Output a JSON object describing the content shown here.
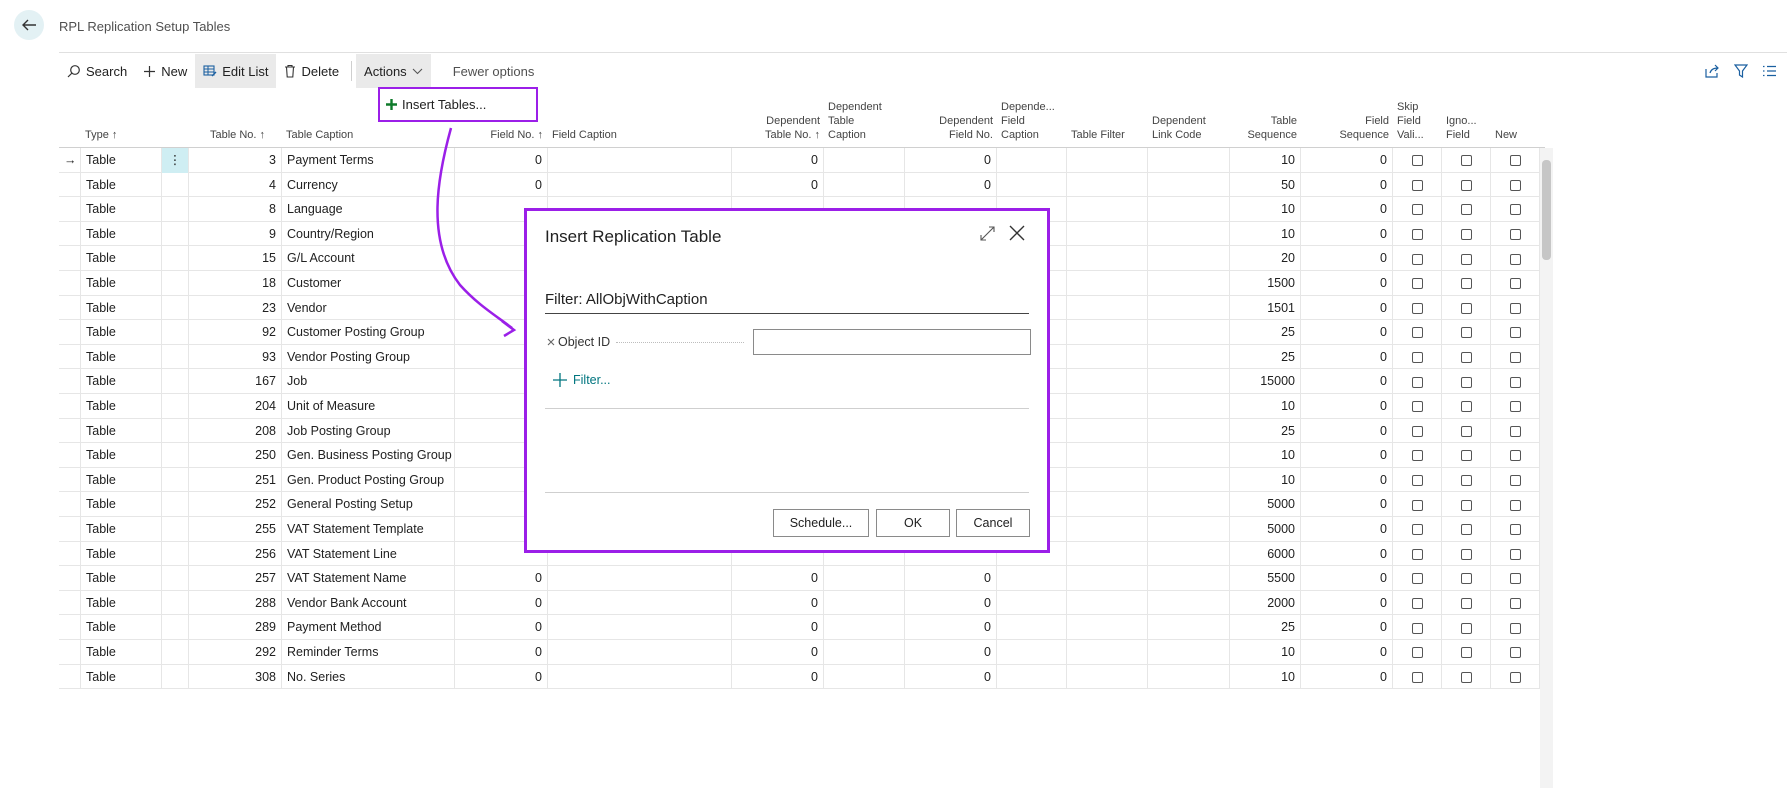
{
  "page": {
    "title": "RPL Replication Setup Tables"
  },
  "toolbar": {
    "search": "Search",
    "new": "New",
    "edit_list": "Edit List",
    "delete": "Delete",
    "actions": "Actions",
    "fewer_options": "Fewer options"
  },
  "dropdown": {
    "insert_tables": "Insert Tables..."
  },
  "columns": {
    "type": "Type ↑",
    "table_no": "Table No. ↑",
    "table_caption": "Table Caption",
    "field_no": "Field No. ↑",
    "field_caption": "Field Caption",
    "dep_table_no_1": "Dependent",
    "dep_table_no_2": "Table No. ↑",
    "dep_table_caption_1": "Dependent",
    "dep_table_caption_2": "Table",
    "dep_table_caption_3": "Caption",
    "dep_field_no_1": "Dependent",
    "dep_field_no_2": "Field No.",
    "dep_field_caption_1": "Depende...",
    "dep_field_caption_2": "Field",
    "dep_field_caption_3": "Caption",
    "table_filter": "Table Filter",
    "dep_link_code_1": "Dependent",
    "dep_link_code_2": "Link Code",
    "table_seq_1": "Table",
    "table_seq_2": "Sequence",
    "field_seq_1": "Field",
    "field_seq_2": "Sequence",
    "skip_1": "Skip",
    "skip_2": "Field",
    "skip_3": "Vali...",
    "ignore_1": "Igno...",
    "ignore_2": "Field",
    "new": "New"
  },
  "rows": [
    {
      "type": "Table",
      "table_no": "3",
      "caption": "Payment Terms",
      "field_no": "0",
      "dep_table_no": "0",
      "dep_field_no": "0",
      "table_seq": "10",
      "field_seq": "0"
    },
    {
      "type": "Table",
      "table_no": "4",
      "caption": "Currency",
      "field_no": "0",
      "dep_table_no": "0",
      "dep_field_no": "0",
      "table_seq": "50",
      "field_seq": "0"
    },
    {
      "type": "Table",
      "table_no": "8",
      "caption": "Language",
      "field_no": "",
      "dep_table_no": "",
      "dep_field_no": "",
      "table_seq": "10",
      "field_seq": "0"
    },
    {
      "type": "Table",
      "table_no": "9",
      "caption": "Country/Region",
      "field_no": "",
      "dep_table_no": "",
      "dep_field_no": "",
      "table_seq": "10",
      "field_seq": "0"
    },
    {
      "type": "Table",
      "table_no": "15",
      "caption": "G/L Account",
      "field_no": "",
      "dep_table_no": "",
      "dep_field_no": "",
      "table_seq": "20",
      "field_seq": "0"
    },
    {
      "type": "Table",
      "table_no": "18",
      "caption": "Customer",
      "field_no": "",
      "dep_table_no": "",
      "dep_field_no": "",
      "table_seq": "1500",
      "field_seq": "0"
    },
    {
      "type": "Table",
      "table_no": "23",
      "caption": "Vendor",
      "field_no": "",
      "dep_table_no": "",
      "dep_field_no": "",
      "table_seq": "1501",
      "field_seq": "0"
    },
    {
      "type": "Table",
      "table_no": "92",
      "caption": "Customer Posting Group",
      "field_no": "",
      "dep_table_no": "",
      "dep_field_no": "",
      "table_seq": "25",
      "field_seq": "0"
    },
    {
      "type": "Table",
      "table_no": "93",
      "caption": "Vendor Posting Group",
      "field_no": "",
      "dep_table_no": "",
      "dep_field_no": "",
      "table_seq": "25",
      "field_seq": "0"
    },
    {
      "type": "Table",
      "table_no": "167",
      "caption": "Job",
      "field_no": "",
      "dep_table_no": "",
      "dep_field_no": "",
      "table_seq": "15000",
      "field_seq": "0"
    },
    {
      "type": "Table",
      "table_no": "204",
      "caption": "Unit of Measure",
      "field_no": "",
      "dep_table_no": "",
      "dep_field_no": "",
      "table_seq": "10",
      "field_seq": "0"
    },
    {
      "type": "Table",
      "table_no": "208",
      "caption": "Job Posting Group",
      "field_no": "",
      "dep_table_no": "",
      "dep_field_no": "",
      "table_seq": "25",
      "field_seq": "0"
    },
    {
      "type": "Table",
      "table_no": "250",
      "caption": "Gen. Business Posting Group",
      "field_no": "",
      "dep_table_no": "",
      "dep_field_no": "",
      "table_seq": "10",
      "field_seq": "0"
    },
    {
      "type": "Table",
      "table_no": "251",
      "caption": "Gen. Product Posting Group",
      "field_no": "",
      "dep_table_no": "",
      "dep_field_no": "",
      "table_seq": "10",
      "field_seq": "0"
    },
    {
      "type": "Table",
      "table_no": "252",
      "caption": "General Posting Setup",
      "field_no": "",
      "dep_table_no": "",
      "dep_field_no": "",
      "table_seq": "5000",
      "field_seq": "0"
    },
    {
      "type": "Table",
      "table_no": "255",
      "caption": "VAT Statement Template",
      "field_no": "",
      "dep_table_no": "",
      "dep_field_no": "",
      "table_seq": "5000",
      "field_seq": "0"
    },
    {
      "type": "Table",
      "table_no": "256",
      "caption": "VAT Statement Line",
      "field_no": "",
      "dep_table_no": "",
      "dep_field_no": "",
      "table_seq": "6000",
      "field_seq": "0"
    },
    {
      "type": "Table",
      "table_no": "257",
      "caption": "VAT Statement Name",
      "field_no": "0",
      "dep_table_no": "0",
      "dep_field_no": "0",
      "table_seq": "5500",
      "field_seq": "0"
    },
    {
      "type": "Table",
      "table_no": "288",
      "caption": "Vendor Bank Account",
      "field_no": "0",
      "dep_table_no": "0",
      "dep_field_no": "0",
      "table_seq": "2000",
      "field_seq": "0"
    },
    {
      "type": "Table",
      "table_no": "289",
      "caption": "Payment Method",
      "field_no": "0",
      "dep_table_no": "0",
      "dep_field_no": "0",
      "table_seq": "25",
      "field_seq": "0"
    },
    {
      "type": "Table",
      "table_no": "292",
      "caption": "Reminder Terms",
      "field_no": "0",
      "dep_table_no": "0",
      "dep_field_no": "0",
      "table_seq": "10",
      "field_seq": "0"
    },
    {
      "type": "Table",
      "table_no": "308",
      "caption": "No. Series",
      "field_no": "0",
      "dep_table_no": "0",
      "dep_field_no": "0",
      "table_seq": "10",
      "field_seq": "0"
    }
  ],
  "dialog": {
    "title": "Insert Replication Table",
    "filter_title": "Filter: AllObjWithCaption",
    "object_id_label": "Object ID",
    "object_id_value": "",
    "add_filter": "Filter...",
    "schedule": "Schedule...",
    "ok": "OK",
    "cancel": "Cancel"
  },
  "colors": {
    "highlight": "#9b1fe8",
    "accent": "#00757f",
    "rowmenu": "#cfeef3"
  },
  "icons": [
    "back-arrow-icon",
    "search-icon",
    "plus-icon",
    "edit-list-icon",
    "delete-icon",
    "chevron-down-icon",
    "share-icon",
    "filter-icon",
    "list-view-icon",
    "expand-icon",
    "close-icon",
    "row-arrow-icon",
    "row-menu-icon"
  ]
}
